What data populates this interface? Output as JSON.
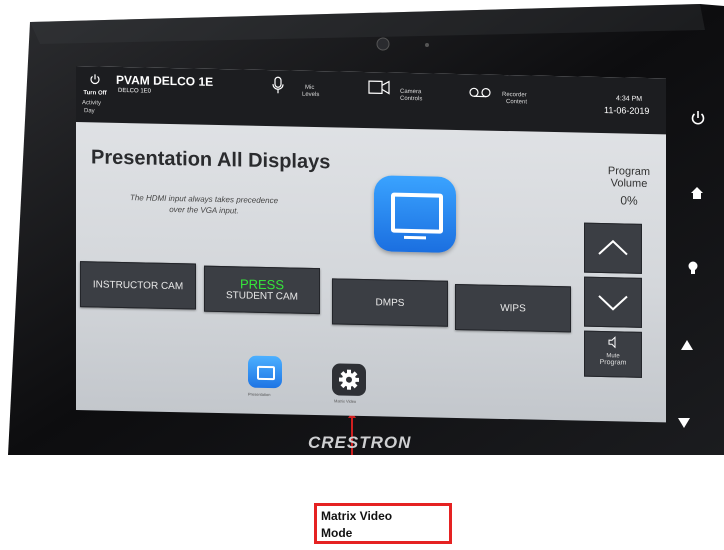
{
  "topbar": {
    "power_label": "Turn Off",
    "room_title": "PVAM DELCO 1E",
    "room_sub": "DELCO 1E0",
    "activity_label": "Activity",
    "activity_value": "Day",
    "mic_levels_line1": "Mic",
    "mic_levels_line2": "Levels",
    "camera_controls_line1": "Camera",
    "camera_controls_line2": "Controls",
    "recorder_line1": "Recorder",
    "recorder_line2": "Content",
    "time": "4:34 PM",
    "date": "11-06-2019"
  },
  "main": {
    "title": "Presentation All Displays",
    "hint_line1": "The HDMI input always takes precedence",
    "hint_line2": "over the VGA input."
  },
  "sources": [
    {
      "label": "INSTRUCTOR CAM",
      "press": ""
    },
    {
      "label": "STUDENT CAM",
      "press": "PRESS"
    },
    {
      "label": "DMPS",
      "press": ""
    },
    {
      "label": "WIPS",
      "press": ""
    }
  ],
  "volume": {
    "title_line1": "Program",
    "title_line2": "Volume",
    "level": "0%",
    "mute_line1": "Mute",
    "mute_line2": "Program"
  },
  "bottom_nav": [
    {
      "label": "Presentation",
      "icon": "monitor-icon",
      "color": "#2188f0"
    },
    {
      "label": "Matrix Video",
      "icon": "gear-icon",
      "color": "#2e3035"
    }
  ],
  "bezel": {
    "brand": "CRESTRON",
    "side_icons": [
      "power-icon",
      "home-icon",
      "light-bulb-icon",
      "triangle-up-icon",
      "triangle-down-icon"
    ]
  },
  "callout": {
    "line1": "Matrix Video",
    "line2": "Mode",
    "border_color": "#e52222"
  }
}
